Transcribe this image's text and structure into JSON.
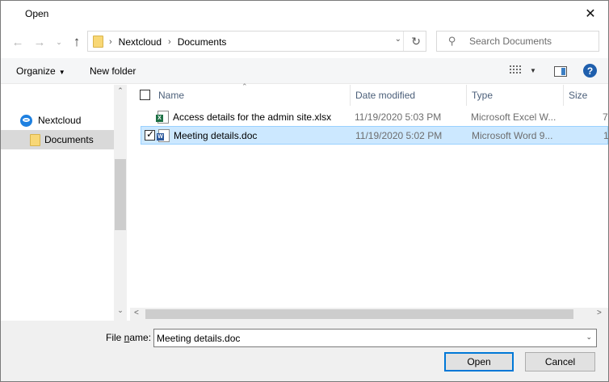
{
  "window": {
    "title": "Open",
    "close_glyph": "✕"
  },
  "nav": {
    "back_icon": "←",
    "forward_icon": "→",
    "recent_icon": "⌄",
    "up_icon": "↑",
    "breadcrumb": [
      "Nextcloud",
      "Documents"
    ],
    "breadcrumb_sep": "›",
    "dropdown_icon": "⌄",
    "refresh_icon": "↻"
  },
  "search": {
    "placeholder": "Search Documents",
    "icon": "⚲"
  },
  "toolbar": {
    "organize_label": "Organize",
    "organize_caret": "▼",
    "new_folder_label": "New folder",
    "view_caret": "▼",
    "help_label": "?"
  },
  "sidebar": {
    "items": [
      {
        "label": "Nextcloud",
        "icon": "nextcloud-icon"
      },
      {
        "label": "Documents",
        "icon": "folder-icon",
        "selected": true
      }
    ],
    "scroll_up": "⌃",
    "scroll_down": "⌄"
  },
  "columns": {
    "name": "Name",
    "date": "Date modified",
    "type": "Type",
    "size": "Size",
    "sort_indicator": "⌃"
  },
  "files": [
    {
      "name": "Access details for the admin site.xlsx",
      "date": "11/19/2020 5:03 PM",
      "type": "Microsoft Excel W...",
      "size": "7",
      "icon": "excel-file-icon",
      "badge": "X",
      "selected": false
    },
    {
      "name": "Meeting details.doc",
      "date": "11/19/2020 5:02 PM",
      "type": "Microsoft Word 9...",
      "size": "1",
      "icon": "word-file-icon",
      "badge": "W",
      "selected": true
    }
  ],
  "hscroll": {
    "left": "<",
    "right": ">"
  },
  "footer": {
    "file_name_label_prefix": "File ",
    "file_name_label_underlined": "n",
    "file_name_label_suffix": "ame:",
    "file_name_value": "Meeting details.doc",
    "file_name_chevron": "⌄",
    "open_label": "Open",
    "cancel_label": "Cancel"
  },
  "colors": {
    "accent": "#0078d7",
    "selection": "#cce8ff",
    "folder": "#f8d775",
    "nextcloud": "#1e80e0"
  }
}
